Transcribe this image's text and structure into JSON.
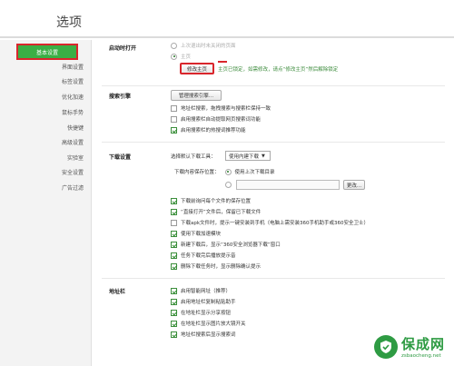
{
  "title": "选项",
  "sidebar": {
    "items": [
      {
        "label": "基本设置",
        "active": true
      },
      {
        "label": "界面设置"
      },
      {
        "label": "标签设置"
      },
      {
        "label": "优化加速"
      },
      {
        "label": "鼠标手势"
      },
      {
        "label": "快捷键"
      },
      {
        "label": "高级设置"
      },
      {
        "label": "实验室"
      },
      {
        "label": "安全设置"
      },
      {
        "label": "广告过滤"
      }
    ]
  },
  "startup": {
    "label": "启动时打开",
    "option_last": "上次退出时未关闭的页面",
    "option_home": "主页",
    "modify_home_button": "修改主页",
    "home_note": "主页已锁定，如需修改，请点“修改主页”然后解除锁定"
  },
  "search": {
    "label": "搜索引擎",
    "manage_button": "管理搜索引擎...",
    "options": [
      {
        "label": "地址栏搜索，拖拽搜索与搜索栏保持一致",
        "checked": false
      },
      {
        "label": "启用搜索栏自动提取网页搜索词功能",
        "checked": false
      },
      {
        "label": "启用搜索栏的热搜词推荐功能",
        "checked": true
      }
    ]
  },
  "download": {
    "label": "下载设置",
    "default_tool_label": "选择默认下载工具：",
    "default_tool_value": "使用内建下载",
    "save_location_label": "下载内容保存位置：",
    "save_last_dir": "使用上次下载目录",
    "path_value": "",
    "change_button": "更改...",
    "options": [
      {
        "label": "下载前询问每个文件的保存位置",
        "checked": true
      },
      {
        "label": "“直接打开”文件后，保留已下载文件",
        "checked": true
      },
      {
        "label": "下载apk文件时，提示一键安装到手机（电脑上需安装360手机助手或360安全卫士）",
        "checked": false
      },
      {
        "label": "使用下载加速模块",
        "checked": true
      },
      {
        "label": "新建下载后，显示“360安全浏览器下载”窗口",
        "checked": true
      },
      {
        "label": "任务下载完后播放提示音",
        "checked": true
      },
      {
        "label": "删除下载任务时，显示删除确认提示",
        "checked": true
      }
    ]
  },
  "addressbar": {
    "label": "地址栏",
    "options": [
      {
        "label": "启用智能网址（推荐）",
        "checked": true
      },
      {
        "label": "启用地址栏复制粘贴助手",
        "checked": true
      },
      {
        "label": "在地址栏显示分享按钮",
        "checked": true
      },
      {
        "label": "在地址栏显示图片放大镜开关",
        "checked": true
      },
      {
        "label": "地址栏搜索后显示搜索词",
        "checked": true
      }
    ]
  },
  "watermark": {
    "title": "保成网",
    "url": "zsbaocheng.net"
  },
  "colors": {
    "accent_green": "#3aaf45",
    "highlight_red": "#d9262c"
  }
}
